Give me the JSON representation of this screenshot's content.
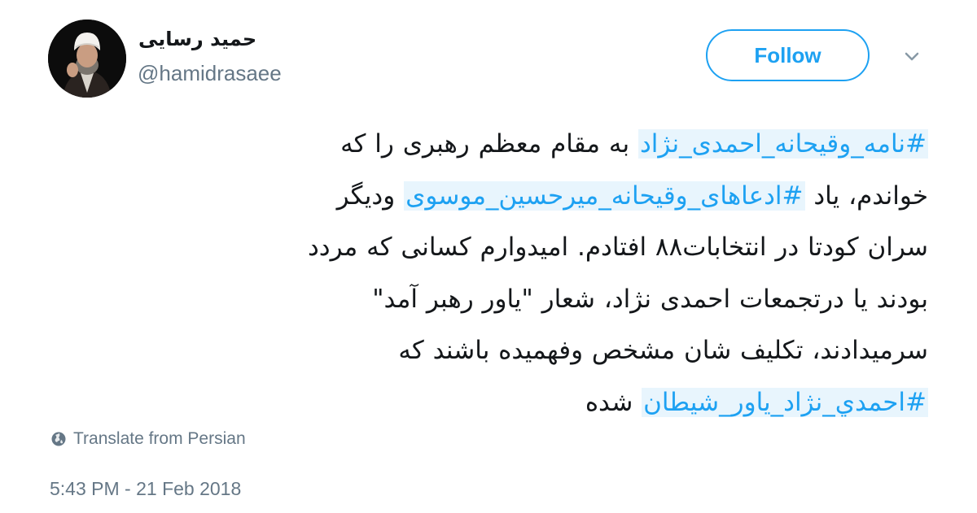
{
  "user": {
    "display_name": "حمید رسایی",
    "username": "@hamidrasaee"
  },
  "follow_button": {
    "label": "Follow"
  },
  "menu": {
    "icon": "chevron-down-icon"
  },
  "tweet": {
    "lines": [
      [
        {
          "text": "#نامه_وقیحانه_احمدی_نژاد",
          "hashtag": true
        },
        {
          "text": " به مقام معظم رهبری را که",
          "hashtag": false
        }
      ],
      [
        {
          "text": "خواندم، یاد ",
          "hashtag": false
        },
        {
          "text": "#ادعاهای_وقیحانه_میرحسین_موسوی",
          "hashtag": true
        },
        {
          "text": " ودیگر",
          "hashtag": false
        }
      ],
      [
        {
          "text": "سران کودتا در انتخابات۸۸ افتادم. امیدوارم کسانی که مردد",
          "hashtag": false
        }
      ],
      [
        {
          "text": "بودند یا درتجمعات احمدی نژاد، شعار \"یاور رهبر آمد\"",
          "hashtag": false
        }
      ],
      [
        {
          "text": "سرمیدادند، تکلیف شان مشخص وفهمیده باشند که",
          "hashtag": false
        }
      ],
      [
        {
          "text": "#احمدي_نژاد_یاور_شیطان",
          "hashtag": true
        },
        {
          "text": " شده",
          "hashtag": false
        }
      ]
    ]
  },
  "translate": {
    "label": "Translate from Persian",
    "icon": "globe-icon"
  },
  "timestamp": "5:43 PM - 21 Feb 2018",
  "colors": {
    "accent": "#1da1f2",
    "secondary_text": "#657786",
    "primary_text": "#14171a",
    "hashtag_highlight": "#e8f5fd"
  }
}
